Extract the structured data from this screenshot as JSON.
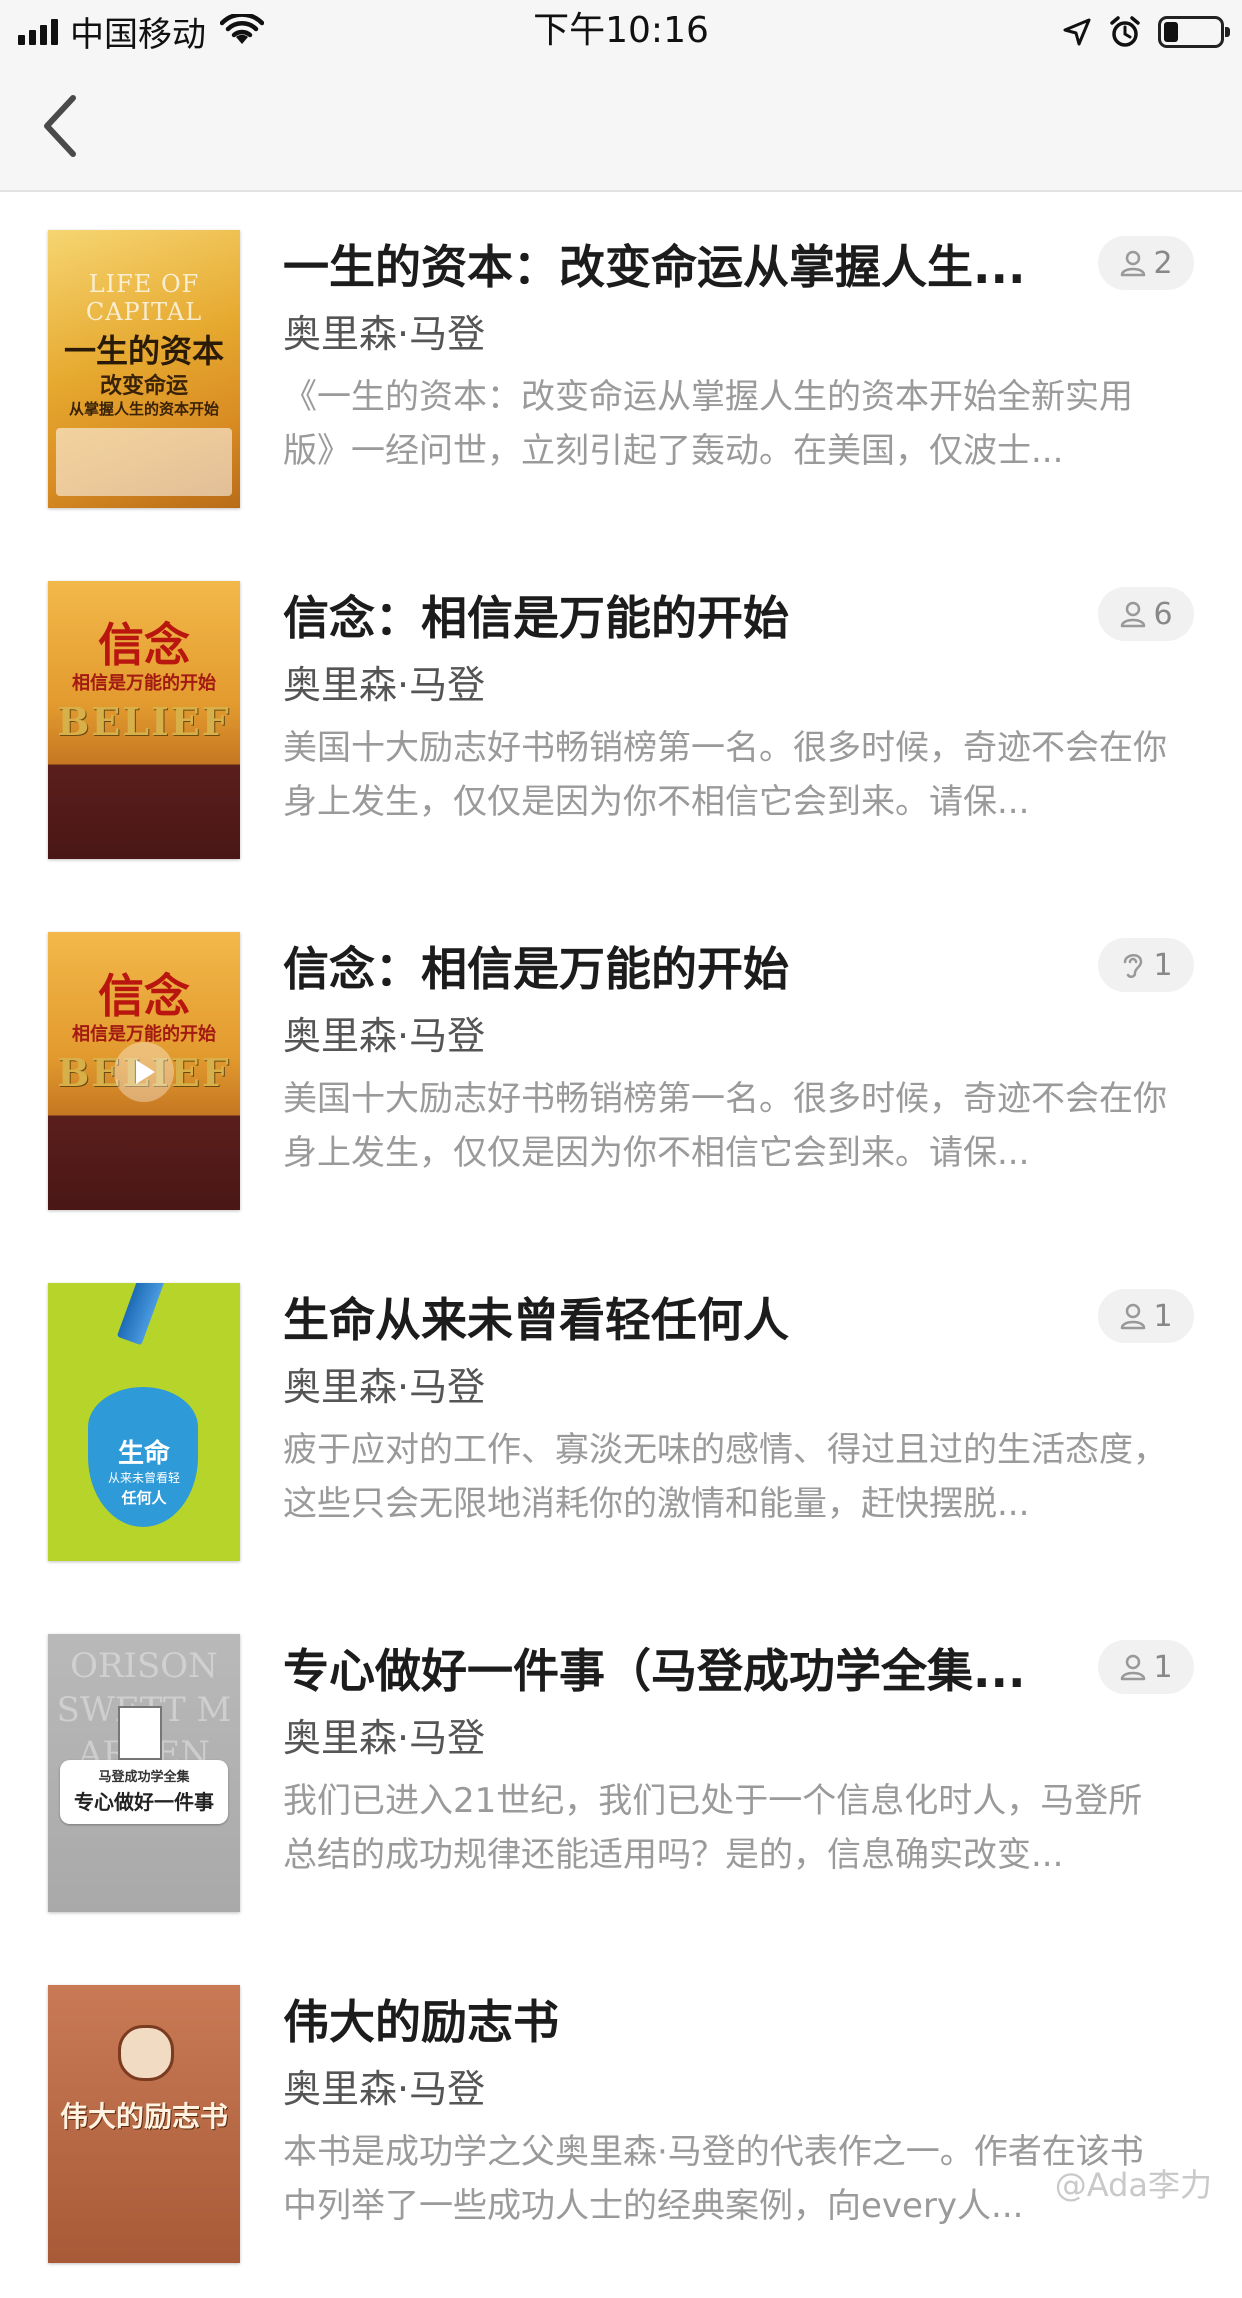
{
  "status_bar": {
    "carrier": "中国移动",
    "time": "下午10:16",
    "battery_percent": 25
  },
  "books": [
    {
      "title": "一生的资本：改变命运从掌握人生...",
      "author": "奥里森·马登",
      "description": "《一生的资本：改变命运从掌握人生的资本开始全新实用版》一经问世，立刻引起了轰动。在美国，仅波士...",
      "count": "2",
      "badge_icon": "person-icon",
      "cover": {
        "main": "一生的资本",
        "sub": "改变命运",
        "sub2": "从掌握人生的资本开始",
        "top": "LIFE OF CAPITAL"
      }
    },
    {
      "title": "信念：相信是万能的开始",
      "author": "奥里森·马登",
      "description": "美国十大励志好书畅销榜第一名。很多时候，奇迹不会在你身上发生，仅仅是因为你不相信它会到来。请保...",
      "count": "6",
      "badge_icon": "person-icon",
      "cover": {
        "main": "信念",
        "sub": "相信是万能的开始",
        "top": "BELIEF"
      }
    },
    {
      "title": "信念：相信是万能的开始",
      "author": "奥里森·马登",
      "description": "美国十大励志好书畅销榜第一名。很多时候，奇迹不会在你身上发生，仅仅是因为你不相信它会到来。请保...",
      "count": "1",
      "badge_icon": "ear-icon",
      "cover": {
        "main": "信念",
        "sub": "相信是万能的开始",
        "top": "BELIEF"
      }
    },
    {
      "title": "生命从来未曾看轻任何人",
      "author": "奥里森·马登",
      "description": "疲于应对的工作、寡淡无味的感情、得过且过的生活态度，这些只会无限地消耗你的激情和能量，赶快摆脱...",
      "count": "1",
      "badge_icon": "person-icon",
      "cover": {
        "main": "生命",
        "sub": "从来未曾看轻",
        "sub2": "任何人"
      }
    },
    {
      "title": "专心做好一件事（马登成功学全集...",
      "author": "奥里森·马登",
      "description": "我们已进入21世纪，我们已处于一个信息化时人，马登所总结的成功规律还能适用吗？是的，信息确实改变...",
      "count": "1",
      "badge_icon": "person-icon",
      "cover": {
        "main": "专心做好一件事",
        "sub": "马登成功学全集",
        "top": "ORISON SWETT MARDEN"
      }
    },
    {
      "title": "伟大的励志书",
      "author": "奥里森·马登",
      "description": "本书是成功学之父奥里森·马登的代表作之一。作者在该书中列举了一些成功人士的经典案例，向every人...",
      "count": "",
      "badge_icon": "",
      "cover": {
        "main": "伟大的励志书"
      }
    }
  ],
  "watermark": "@Ada李力",
  "colors": {
    "accent": "#9a9a9a"
  }
}
